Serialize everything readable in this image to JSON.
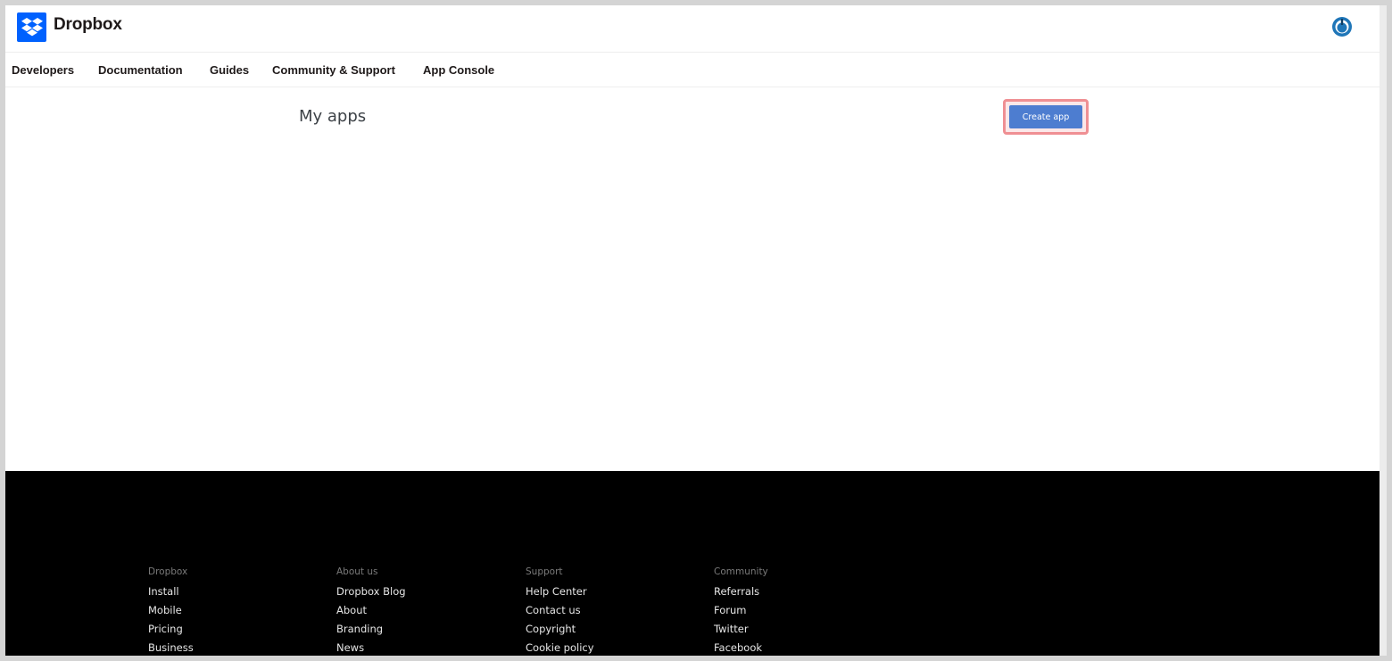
{
  "header": {
    "brand": "Dropbox",
    "logo_icon": "dropbox-logo-icon",
    "account_icon": "user-account-icon",
    "brand_color": "#0061fe"
  },
  "nav": {
    "items": [
      "Developers",
      "Documentation",
      "Guides",
      "Community & Support",
      "App Console"
    ]
  },
  "main": {
    "title": "My apps",
    "create_button": "Create app",
    "button_color": "#4d7dd0",
    "highlight_color": "#ef8f93"
  },
  "footer": {
    "columns": [
      {
        "heading": "Dropbox",
        "links": [
          "Install",
          "Mobile",
          "Pricing",
          "Business"
        ]
      },
      {
        "heading": "About us",
        "links": [
          "Dropbox Blog",
          "About",
          "Branding",
          "News"
        ]
      },
      {
        "heading": "Support",
        "links": [
          "Help Center",
          "Contact us",
          "Copyright",
          "Cookie policy"
        ]
      },
      {
        "heading": "Community",
        "links": [
          "Referrals",
          "Forum",
          "Twitter",
          "Facebook"
        ]
      }
    ]
  }
}
